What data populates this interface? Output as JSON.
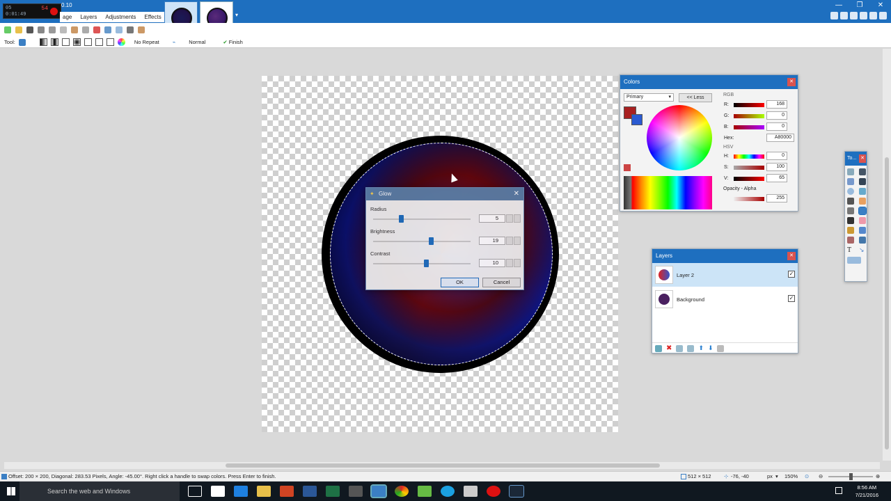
{
  "app": {
    "version": "0.10",
    "menu": [
      "age",
      "Layers",
      "Adjustments",
      "Effects"
    ],
    "recorder": {
      "line1": "05",
      "line2": "0:01:49",
      "line3": "54"
    }
  },
  "tooloptions": {
    "tool_label": "Tool:",
    "repeat": "No Repeat",
    "blend": "Normal",
    "finish": "Finish"
  },
  "colors_panel": {
    "title": "Colors",
    "primary_select": "Primary",
    "less_button": "<< Less",
    "rgb_label": "RGB",
    "r_label": "R:",
    "r_value": "168",
    "g_label": "G:",
    "g_value": "0",
    "b_label": "B:",
    "b_value": "0",
    "hex_label": "Hex:",
    "hex_value": "A80000",
    "hsv_label": "HSV",
    "h_label": "H:",
    "h_value": "0",
    "s_label": "S:",
    "s_value": "100",
    "v_label": "V:",
    "v_value": "65",
    "alpha_label": "Opacity - Alpha",
    "alpha_value": "255",
    "primary_color": "#a82020",
    "secondary_color": "#2a5ad1"
  },
  "tools_panel": {
    "title": "To..."
  },
  "layers_panel": {
    "title": "Layers",
    "layers": [
      {
        "name": "Layer 2",
        "selected": true,
        "visible": true
      },
      {
        "name": "Background",
        "selected": false,
        "visible": true
      }
    ]
  },
  "glow_dialog": {
    "title": "Glow",
    "radius_label": "Radius",
    "radius_value": "5",
    "radius_level": 0.28,
    "brightness_label": "Brightness",
    "brightness_value": "19",
    "brightness_level": 0.6,
    "contrast_label": "Contrast",
    "contrast_value": "10",
    "contrast_level": 0.55,
    "ok_label": "OK",
    "cancel_label": "Cancel"
  },
  "status": {
    "message": "Offset: 200 × 200, Diagonal: 283.53 Pixels, Angle: -45.00°. Right click a handle to swap colors. Press Enter to finish.",
    "size": "512 × 512",
    "cursor": "-76, -40",
    "unit": "px",
    "zoom": "150%"
  },
  "taskbar": {
    "search_placeholder": "Search the web and Windows",
    "time": "8:56 AM",
    "date": "7/21/2016"
  },
  "icon_colors": {
    "accent": "#1e6fbf",
    "close": "#d9534f"
  }
}
